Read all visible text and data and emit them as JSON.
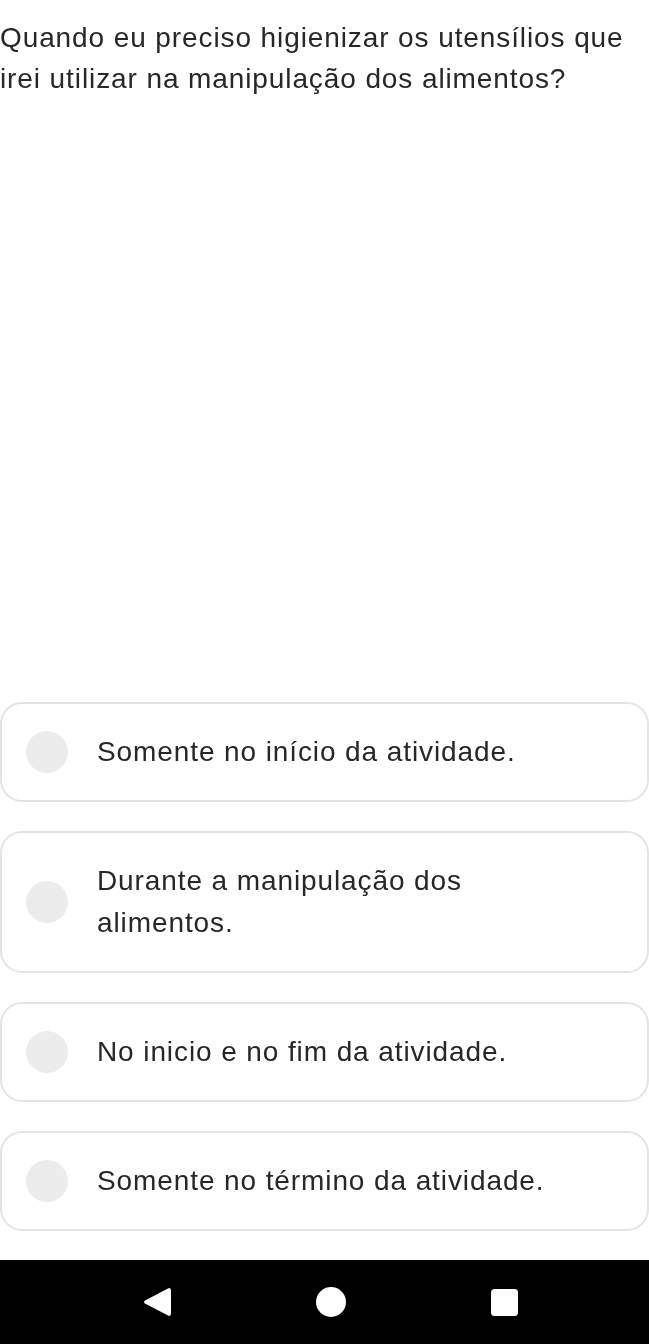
{
  "question": "Quando eu preciso higienizar os utensílios que irei utilizar na manipulação dos alimentos?",
  "options": [
    {
      "text": "Somente no início da atividade.",
      "selected": false
    },
    {
      "text": "Durante a manipulação dos alimentos.",
      "selected": false
    },
    {
      "text": "No inicio e no fim da atividade.",
      "selected": false
    },
    {
      "text": "Somente no término da atividade.",
      "selected": false
    }
  ],
  "nav_bar": [
    {
      "kind": "back"
    },
    {
      "kind": "home"
    },
    {
      "kind": "recents"
    }
  ]
}
